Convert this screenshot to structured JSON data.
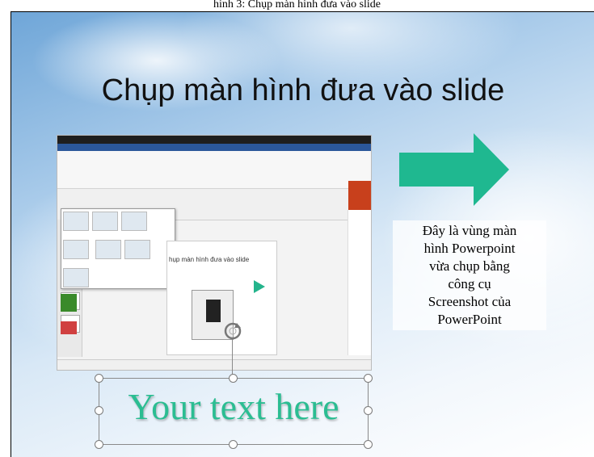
{
  "header_caption": "hình 3: Chụp màn hình đưa vào slide",
  "slide": {
    "title": "Chụp màn hình đưa vào slide",
    "caption_lines": [
      "Đây là vùng màn",
      "hình Powerpoint",
      "vừa chụp bằng",
      "công cụ",
      "Screenshot của",
      "PowerPoint"
    ],
    "textbox_text": "Your text here",
    "mini_slide_title": "hụp màn hình đưa vào slide"
  },
  "colors": {
    "arrow": "#1fb890",
    "textbox_text": "#2bbd92",
    "ppt_orange": "#c8401c"
  },
  "icons": {
    "arrow": "right-arrow-icon",
    "rotate": "rotate-handle-icon"
  }
}
